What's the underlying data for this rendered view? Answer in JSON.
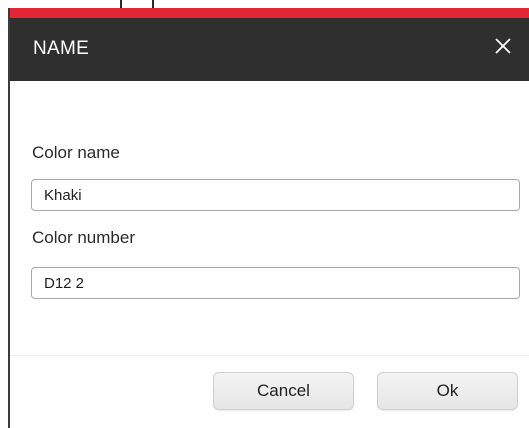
{
  "dialog": {
    "title": "NAME",
    "close_icon": "close-icon",
    "accent_color": "#e22634",
    "titlebar_color": "#2f2f2f"
  },
  "form": {
    "color_name": {
      "label": "Color name",
      "value": "Khaki"
    },
    "color_number": {
      "label": "Color number",
      "value": "D12 2"
    }
  },
  "buttons": {
    "cancel_label": "Cancel",
    "ok_label": "Ok"
  }
}
